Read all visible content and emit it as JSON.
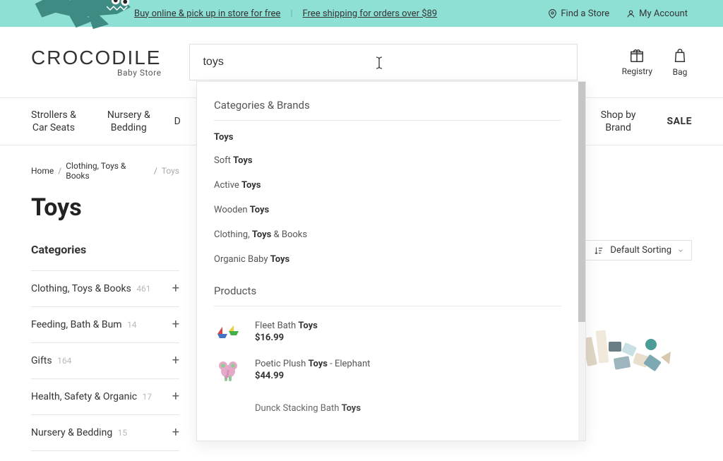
{
  "topbar": {
    "promo1": "Buy online & pick up in store for free",
    "promo2": "Free shipping for orders over $89",
    "find_store": "Find a Store",
    "my_account": "My Account"
  },
  "brand": {
    "name": "CROCODILE",
    "tagline": "Baby Store"
  },
  "search": {
    "value": "toys"
  },
  "header_utils": {
    "registry": "Registry",
    "bag": "Bag"
  },
  "nav": {
    "items": [
      "Strollers &\nCar Seats",
      "Nursery &\nBedding",
      "D",
      "Shop by\nBrand"
    ],
    "sale": "SALE"
  },
  "breadcrumbs": {
    "items": [
      "Home",
      "Clothing, Toys & Books"
    ],
    "current": "Toys"
  },
  "page": {
    "title": "Toys",
    "categories_heading": "Categories"
  },
  "categories": [
    {
      "label": "Clothing, Toys & Books",
      "count": "461"
    },
    {
      "label": "Feeding, Bath & Bum",
      "count": "14"
    },
    {
      "label": "Gifts",
      "count": "164"
    },
    {
      "label": "Health, Safety & Organic",
      "count": "17"
    },
    {
      "label": "Nursery & Bedding",
      "count": "15"
    }
  ],
  "sort": {
    "label": "Default Sorting"
  },
  "autocomplete": {
    "categories_title": "Categories & Brands",
    "heading": "Toys",
    "items": [
      {
        "prefix": "Soft ",
        "match": "Toys",
        "suffix": ""
      },
      {
        "prefix": "Active ",
        "match": "Toys",
        "suffix": ""
      },
      {
        "prefix": "Wooden ",
        "match": "Toys",
        "suffix": ""
      },
      {
        "prefix": "Clothing, ",
        "match": "Toys",
        "suffix": " & Books"
      },
      {
        "prefix": "Organic Baby ",
        "match": "Toys",
        "suffix": ""
      }
    ],
    "products_title": "Products",
    "products": [
      {
        "name_prefix": "Fleet Bath ",
        "name_match": "Toys",
        "name_suffix": "",
        "price": "$16.99",
        "thumb": "boats"
      },
      {
        "name_prefix": "Poetic Plush ",
        "name_match": "Toys",
        "name_suffix": " - Elephant",
        "price": "$44.99",
        "thumb": "elephant"
      },
      {
        "name_prefix": "Dunck Stacking Bath ",
        "name_match": "Toys",
        "name_suffix": "",
        "price": "",
        "thumb": ""
      }
    ]
  }
}
